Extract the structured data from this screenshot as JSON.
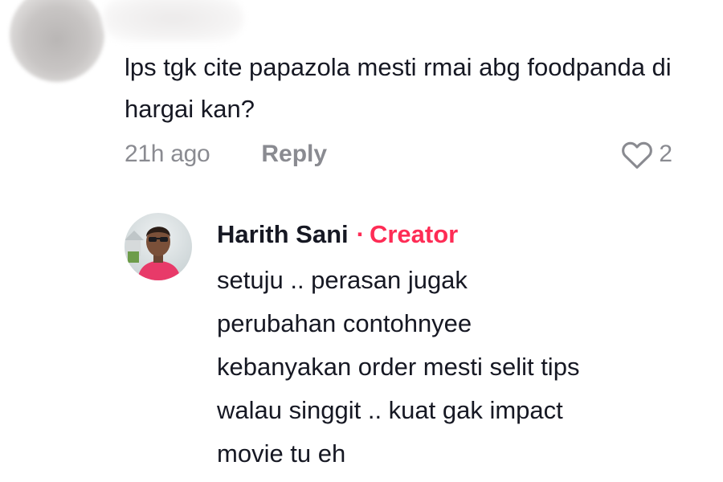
{
  "comment": {
    "text": "lps tgk cite papazola mesti rmai abg foodpanda di hargai kan?",
    "time": "21h ago",
    "reply_label": "Reply",
    "likes": "2",
    "like_icon": "heart-outline-icon"
  },
  "reply": {
    "author": "Harith Sani",
    "separator": "·",
    "badge": "Creator",
    "lines": [
      "setuju .. perasan jugak",
      "perubahan contohnyee",
      "kebanyakan order mesti selit tips",
      "walau singgit .. kuat gak impact",
      "movie tu eh"
    ]
  },
  "colors": {
    "text": "#161823",
    "muted": "#8a8b91",
    "accent": "#fe2c55"
  }
}
